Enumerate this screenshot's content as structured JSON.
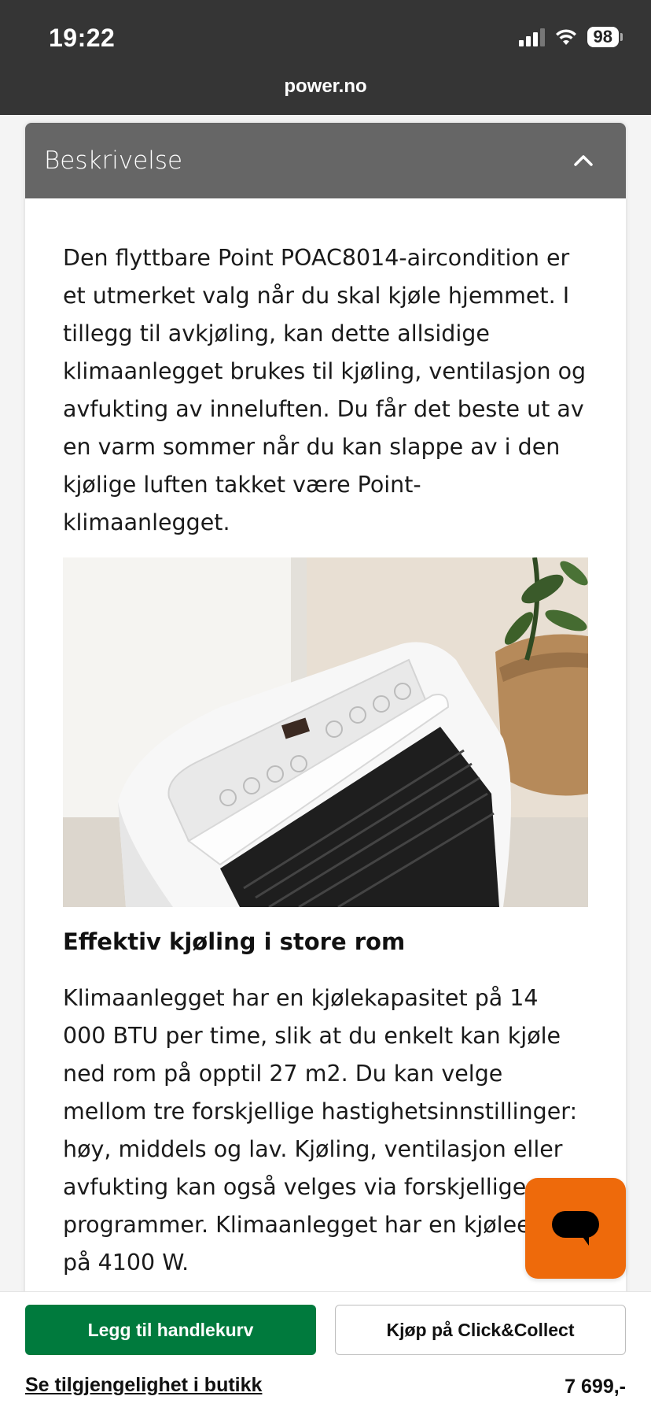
{
  "status_bar": {
    "time": "19:22",
    "battery": "98",
    "icons": [
      "cellular-signal-icon",
      "wifi-icon",
      "battery-icon"
    ]
  },
  "browser": {
    "url": "power.no"
  },
  "section": {
    "title": "Beskrivelse",
    "toggle_icon": "chevron-up-icon"
  },
  "description": {
    "intro": "Den flyttbare Point POAC8014-aircondition er et utmerket valg når du skal kjøle hjemmet. I tillegg til avkjøling, kan dette allsidige klimaanlegget brukes til kjøling, ventilasjon og avfukting av inneluften. Du får det beste ut av en varm sommer når du kan slappe av i den kjølige luften takket være Point-klimaanlegget.",
    "subheading": "Effektiv kjøling i store rom",
    "body": "Klimaanlegget har en kjølekapasitet på 14 000 BTU per time, slik at du enkelt kan kjøle ned rom på opptil 27 m2. Du kan velge mellom tre forskjellige hastighetsinnstillinger: høy, middels og lav. Kjøling, ventilasjon eller avfukting kan også velges via forskjellige programmer. Klimaanlegget har en kjøleeffekt på 4100 W."
  },
  "chat": {
    "icon": "chat-bubble-icon",
    "color": "#ee6a0b"
  },
  "actions": {
    "add_to_cart": "Legg til handlekurv",
    "click_collect": "Kjøp på Click&Collect",
    "store_availability": "Se tilgjengelighet i butikk",
    "price": "7 699,-"
  },
  "colors": {
    "brand_green": "#007a3d",
    "header_gray": "#666666",
    "chrome_dark": "#353535"
  }
}
